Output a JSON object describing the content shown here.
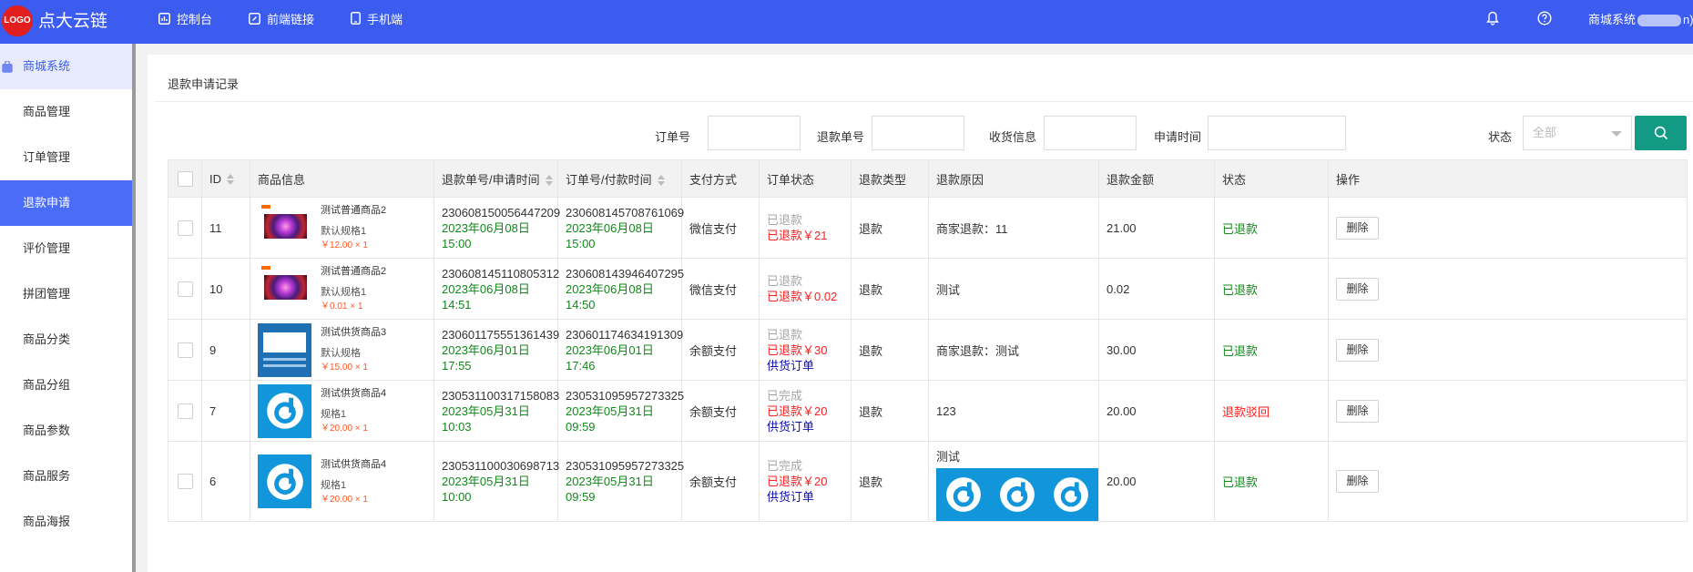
{
  "header": {
    "logo_text": "LOGO",
    "brand": "点大云链",
    "nav": [
      {
        "label": "控制台",
        "icon": "dashboard-icon"
      },
      {
        "label": "前端链接",
        "icon": "link-icon"
      },
      {
        "label": "手机端",
        "icon": "mobile-icon"
      }
    ],
    "user_prefix": "商城系统",
    "user_suffix": "n)"
  },
  "sidebar": {
    "section": "商城系统",
    "items": [
      "商品管理",
      "订单管理",
      "退款申请",
      "评价管理",
      "拼团管理",
      "商品分类",
      "商品分组",
      "商品参数",
      "商品服务",
      "商品海报"
    ],
    "active": "退款申请"
  },
  "page": {
    "title": "退款申请记录"
  },
  "filters": {
    "order_no_label": "订单号",
    "refund_no_label": "退款单号",
    "receiver_label": "收货信息",
    "apply_time_label": "申请时间",
    "status_label": "状态",
    "status_value": "全部",
    "order_no_value": "",
    "refund_no_value": "",
    "receiver_value": "",
    "apply_time_value": ""
  },
  "table": {
    "columns": [
      "ID",
      "商品信息",
      "退款单号/申请时间",
      "订单号/付款时间",
      "支付方式",
      "订单状态",
      "退款类型",
      "退款原因",
      "退款金额",
      "状态",
      "操作"
    ],
    "rows": [
      {
        "id": "11",
        "thumb": "tv",
        "product_name": "测试普通商品2",
        "spec": "默认规格1",
        "price": "￥12.00 × 1",
        "refund_no": "230608150056447209",
        "refund_time": "2023年06月08日 15:00",
        "order_no": "230608145708761069",
        "pay_time": "2023年06月08日 15:00",
        "pay_method": "微信支付",
        "order_status": "已退款",
        "order_status_refund": "已退款￥21",
        "order_status_extra": "",
        "refund_type": "退款",
        "reason": "商家退款：11",
        "reason_image": false,
        "amount": "21.00",
        "status": "已退款",
        "status_color": "green",
        "action": "删除"
      },
      {
        "id": "10",
        "thumb": "tv",
        "product_name": "测试普通商品2",
        "spec": "默认规格1",
        "price": "￥0.01 × 1",
        "refund_no": "230608145110805312",
        "refund_time": "2023年06月08日 14:51",
        "order_no": "230608143946407295",
        "pay_time": "2023年06月08日 14:50",
        "pay_method": "微信支付",
        "order_status": "已退款",
        "order_status_refund": "已退款￥0.02",
        "order_status_extra": "",
        "refund_type": "退款",
        "reason": "测试",
        "reason_image": false,
        "amount": "0.02",
        "status": "已退款",
        "status_color": "green",
        "action": "删除"
      },
      {
        "id": "9",
        "thumb": "book",
        "product_name": "测试供货商品3",
        "spec": "默认规格",
        "price": "￥15.00 × 1",
        "refund_no": "230601175551361439",
        "refund_time": "2023年06月01日 17:55",
        "order_no": "230601174634191309",
        "pay_time": "2023年06月01日 17:46",
        "pay_method": "余额支付",
        "order_status": "已退款",
        "order_status_refund": "已退款￥30",
        "order_status_extra": "供货订单",
        "refund_type": "退款",
        "reason": "商家退款：测试",
        "reason_image": false,
        "amount": "30.00",
        "status": "已退款",
        "status_color": "green",
        "action": "删除"
      },
      {
        "id": "7",
        "thumb": "blue",
        "product_name": "测试供货商品4",
        "spec": "规格1",
        "price": "￥20.00 × 1",
        "refund_no": "230531100317158083",
        "refund_time": "2023年05月31日 10:03",
        "order_no": "230531095957273325",
        "pay_time": "2023年05月31日 09:59",
        "pay_method": "余额支付",
        "order_status": "已完成",
        "order_status_refund": "已退款￥20",
        "order_status_extra": "供货订单",
        "refund_type": "退款",
        "reason": "123",
        "reason_image": false,
        "amount": "20.00",
        "status": "退款驳回",
        "status_color": "red",
        "action": "删除"
      },
      {
        "id": "6",
        "thumb": "blue",
        "product_name": "测试供货商品4",
        "spec": "规格1",
        "price": "￥20.00 × 1",
        "refund_no": "230531100030698713",
        "refund_time": "2023年05月31日 10:00",
        "order_no": "230531095957273325",
        "pay_time": "2023年05月31日 09:59",
        "pay_method": "余额支付",
        "order_status": "已完成",
        "order_status_refund": "已退款￥20",
        "order_status_extra": "供货订单",
        "refund_type": "退款",
        "reason": "测试",
        "reason_image": true,
        "amount": "20.00",
        "status": "已退款",
        "status_color": "green",
        "action": "删除"
      }
    ]
  },
  "colors": {
    "primary": "#3c5cf0",
    "search_button": "#139a84",
    "status_green": "#11891a",
    "status_red": "#ff1f1f",
    "price_orange": "#ff5722"
  }
}
